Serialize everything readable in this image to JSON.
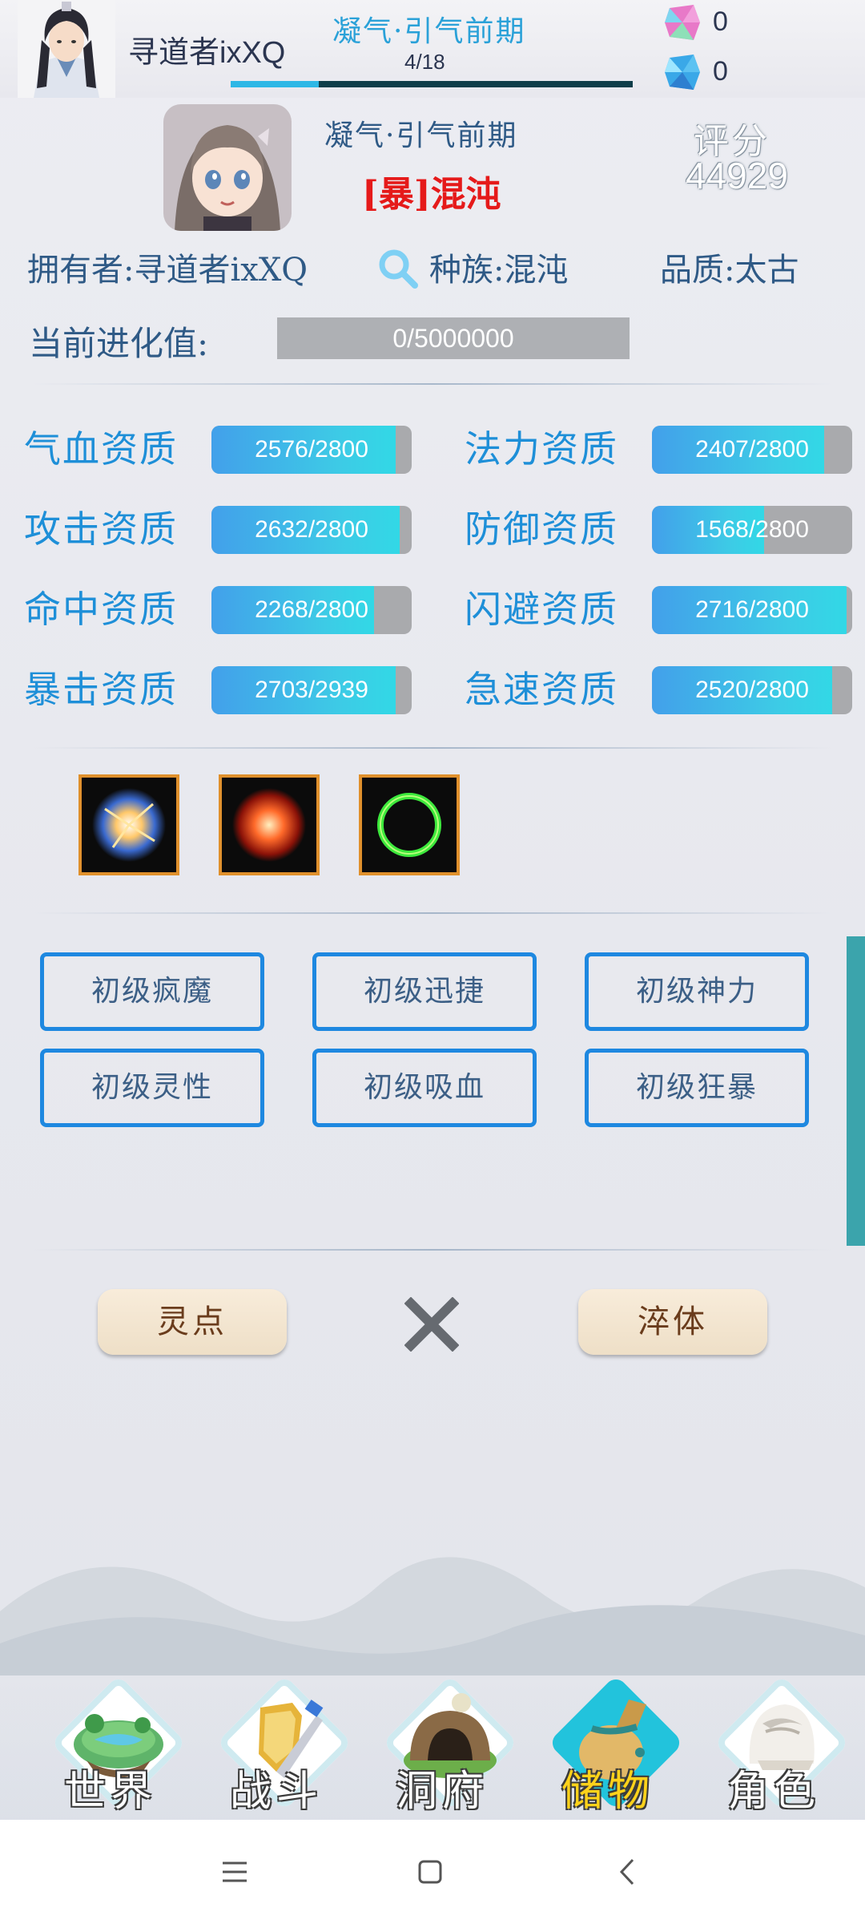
{
  "header": {
    "player_name": "寻道者ixXQ",
    "realm": "凝气·引气前期",
    "exp_text": "4/18",
    "exp_fraction": 0.22,
    "gem_pink_count": "0",
    "gem_blue_count": "0"
  },
  "pet": {
    "realm": "凝气·引气前期",
    "name": "[暴]混沌",
    "score_label": "评分",
    "score": "44929",
    "owner_label": "拥有者:",
    "owner": "寻道者ixXQ",
    "race": "种族:混沌",
    "quality": "品质:太古",
    "evolution_label": "当前进化值:",
    "evolution_value": "0/5000000"
  },
  "stats": [
    {
      "label": "气血资质",
      "text": "2576/2800",
      "fill": 0.92
    },
    {
      "label": "法力资质",
      "text": "2407/2800",
      "fill": 0.86
    },
    {
      "label": "攻击资质",
      "text": "2632/2800",
      "fill": 0.94
    },
    {
      "label": "防御资质",
      "text": "1568/2800",
      "fill": 0.56
    },
    {
      "label": "命中资质",
      "text": "2268/2800",
      "fill": 0.81
    },
    {
      "label": "闪避资质",
      "text": "2716/2800",
      "fill": 0.97
    },
    {
      "label": "暴击资质",
      "text": "2703/2939",
      "fill": 0.92
    },
    {
      "label": "急速资质",
      "text": "2520/2800",
      "fill": 0.9
    }
  ],
  "skills": [
    {
      "icon": "energy-burst-icon",
      "color": "#d8e8ff"
    },
    {
      "icon": "fire-orb-icon",
      "color": "#ff5a2a"
    },
    {
      "icon": "green-ring-icon",
      "color": "#36d83a"
    }
  ],
  "traits": [
    "初级疯魔",
    "初级迅捷",
    "初级神力",
    "初级灵性",
    "初级吸血",
    "初级狂暴"
  ],
  "actions": {
    "left_label": "灵点",
    "right_label": "淬体"
  },
  "nav": [
    {
      "label": "世界",
      "icon": "world-island-icon",
      "active": false
    },
    {
      "label": "战斗",
      "icon": "sword-shield-icon",
      "active": false
    },
    {
      "label": "洞府",
      "icon": "cave-icon",
      "active": false
    },
    {
      "label": "储物",
      "icon": "storage-bag-icon",
      "active": true
    },
    {
      "label": "角色",
      "icon": "character-icon",
      "active": false
    }
  ],
  "colors": {
    "stat_label": "#1e8fd8",
    "pet_name": "#e51a1a",
    "active_nav": "#ffd21a",
    "trait_border": "#1e88e0"
  }
}
